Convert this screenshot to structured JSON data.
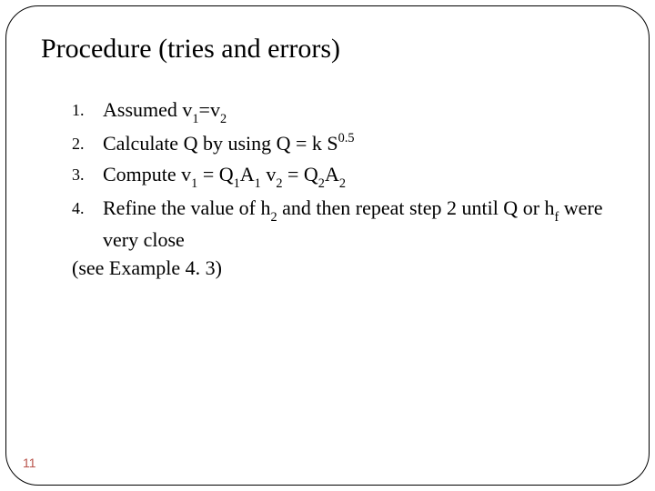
{
  "title": "Procedure (tries and errors)",
  "items": [
    {
      "marker": "1.",
      "html": "Assumed v<sub class='sub1'>1</sub>=v<sub class='sub1'>2</sub>"
    },
    {
      "marker": "2.",
      "html": "Calculate Q by using Q = k S<sup class='sup1'>0.5</sup>"
    },
    {
      "marker": "3.",
      "html": "Compute v<sub class='sub1'>1</sub> = Q<sub class='sub1'>1</sub>A<sub class='sub1'>1</sub> v<sub class='sub1'>2</sub> = Q<sub class='sub1'>2</sub>A<sub class='sub1'>2</sub>"
    },
    {
      "marker": "4.",
      "html": "Refine the value of h<sub class='sub1'>2</sub> and then repeat step 2 until Q or h<sub class='sub1'>f</sub> were very close"
    }
  ],
  "note": "(see Example 4. 3)",
  "page_number": "11"
}
